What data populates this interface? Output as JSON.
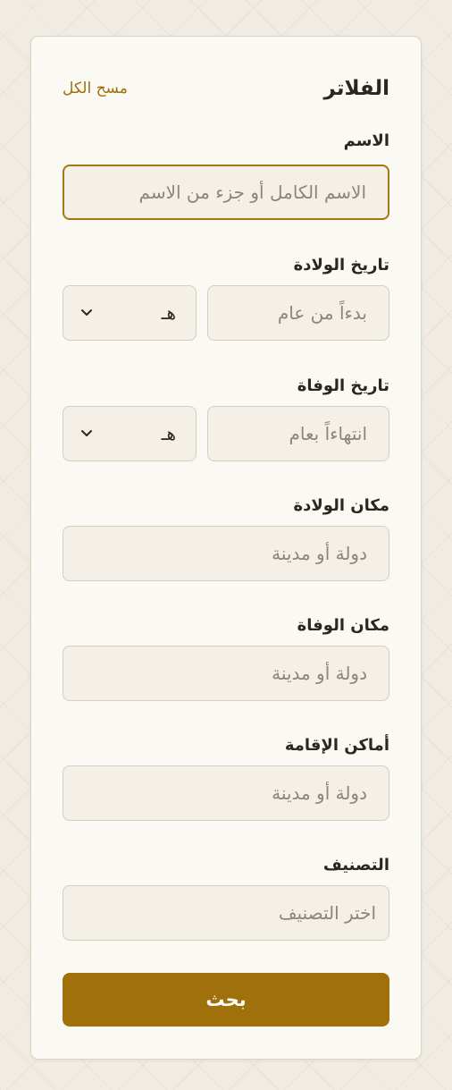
{
  "filters": {
    "title": "الفلاتر",
    "clear_all": "مسح الكل"
  },
  "name": {
    "label": "الاسم",
    "placeholder": "الاسم الكامل أو جزء من الاسم"
  },
  "birth_date": {
    "label": "تاريخ الولادة",
    "placeholder": "بدءاً من عام",
    "calendar": "هـ"
  },
  "death_date": {
    "label": "تاريخ الوفاة",
    "placeholder": "انتهاءاً بعام",
    "calendar": "هـ"
  },
  "birth_place": {
    "label": "مكان الولادة",
    "placeholder": "دولة أو مدينة"
  },
  "death_place": {
    "label": "مكان الوفاة",
    "placeholder": "دولة أو مدينة"
  },
  "residences": {
    "label": "أماكن الإقامة",
    "placeholder": "دولة أو مدينة"
  },
  "category": {
    "label": "التصنيف",
    "placeholder": "اختر التصنيف"
  },
  "search_button": "بحث",
  "colors": {
    "accent": "#a0700a",
    "panel_bg": "#fbf9f4",
    "input_bg": "#f4f0e8",
    "border": "#d6cdbd"
  }
}
